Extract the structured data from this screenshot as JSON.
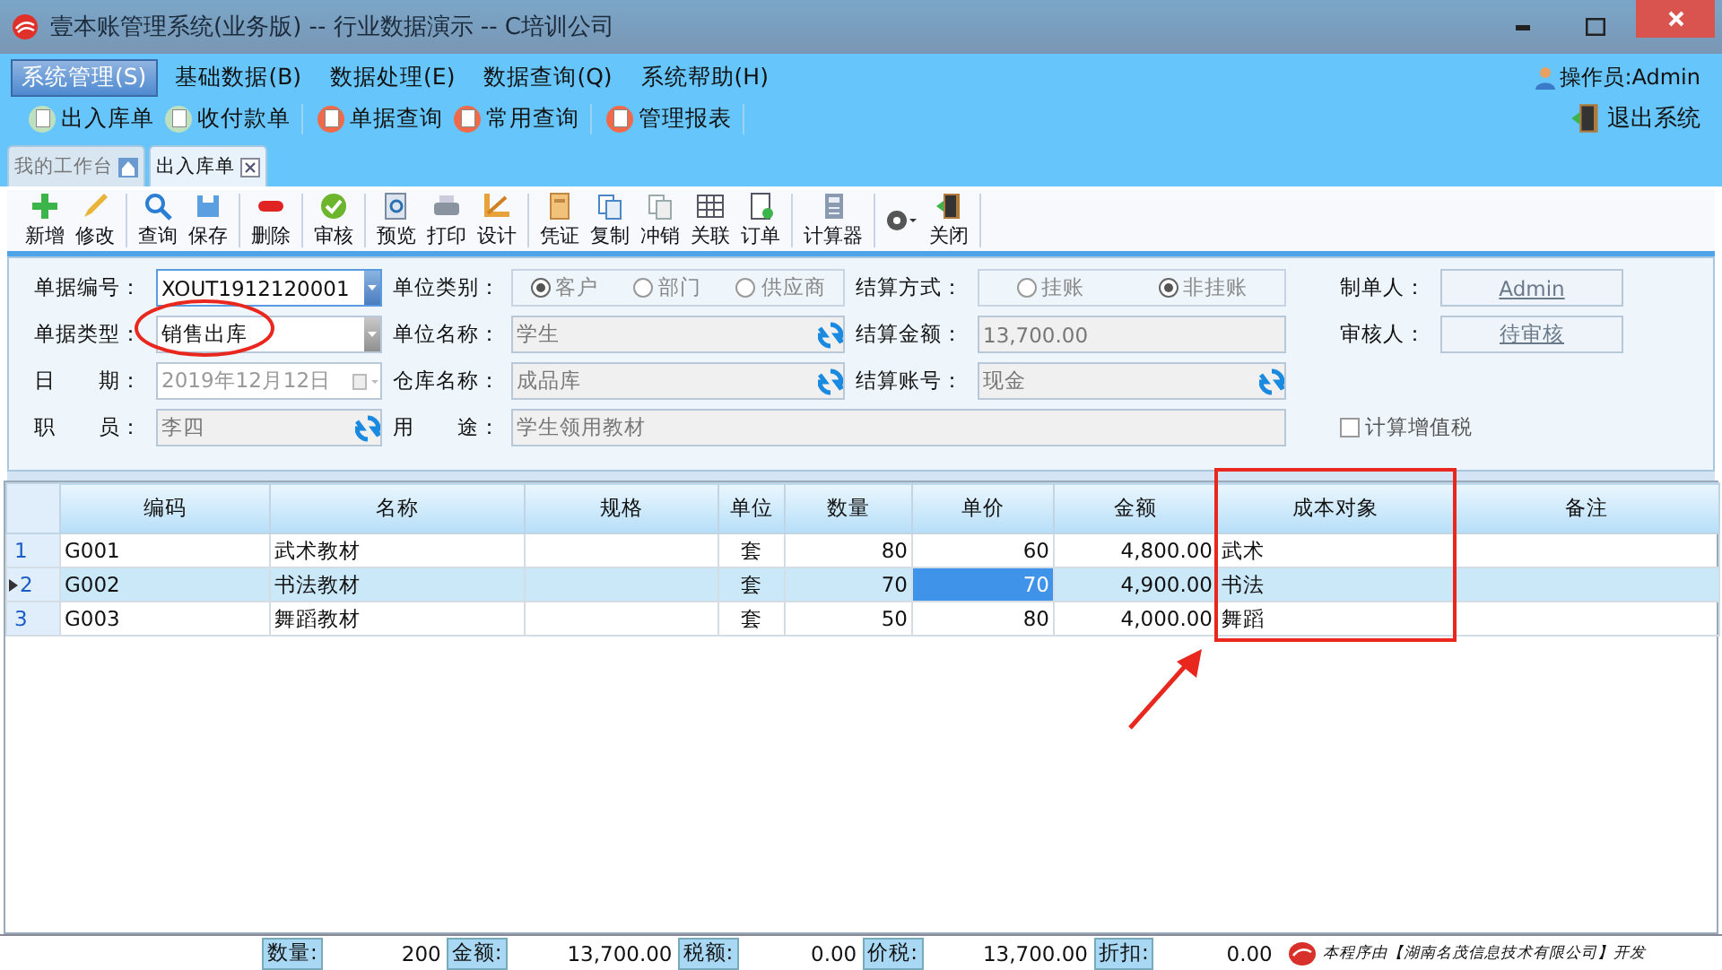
{
  "window": {
    "title": "壹本账管理系统(业务版) -- 行业数据演示 -- C培训公司"
  },
  "menu": [
    {
      "label": "系统管理(S)",
      "selected": true
    },
    {
      "label": "基础数据(B)",
      "selected": false
    },
    {
      "label": "数据处理(E)",
      "selected": false
    },
    {
      "label": "数据查询(Q)",
      "selected": false
    },
    {
      "label": "系统帮助(H)",
      "selected": false
    }
  ],
  "operator": "操作员:Admin",
  "quick_toolbar": [
    [
      "出入库单",
      "收付款单"
    ],
    [
      "单据查询",
      "常用查询"
    ],
    [
      "管理报表"
    ]
  ],
  "exit_button": "退出系统",
  "tabs": [
    {
      "label": "我的工作台",
      "selected": false
    },
    {
      "label": "出入库单",
      "selected": true
    }
  ],
  "toolbar": [
    [
      "新增",
      "修改"
    ],
    [
      "查询",
      "保存"
    ],
    [
      "删除"
    ],
    [
      "审核"
    ],
    [
      "预览",
      "打印",
      "设计"
    ],
    [
      "凭证",
      "复制",
      "冲销",
      "关联",
      "订单"
    ],
    [
      "计算器"
    ],
    [
      "关闭"
    ]
  ],
  "form": {
    "main": [
      [
        {
          "kind": "select",
          "label": "单据编号：",
          "value": "XOUT1912120001",
          "focused": true
        },
        {
          "kind": "radio",
          "label": "单位类别：",
          "options": [
            {
              "label": "客户",
              "selected": true
            },
            {
              "label": "部门",
              "selected": false
            },
            {
              "label": "供应商",
              "selected": false
            }
          ]
        },
        {
          "kind": "radio",
          "label": "结算方式：",
          "options": [
            {
              "label": "挂账",
              "selected": false
            },
            {
              "label": "非挂账",
              "selected": true
            }
          ]
        }
      ],
      [
        {
          "kind": "select",
          "label": "单据类型：",
          "value": "销售出库",
          "focused": false
        },
        {
          "kind": "lookup",
          "label": "单位名称：",
          "value": "学生"
        },
        {
          "kind": "text",
          "label": "结算金额：",
          "value": "13,700.00"
        }
      ],
      [
        {
          "kind": "date",
          "label": "日　　期：",
          "value": "2019年12月12日"
        },
        {
          "kind": "lookup",
          "label": "仓库名称：",
          "value": "成品库"
        },
        {
          "kind": "lookup",
          "label": "结算账号：",
          "value": "现金"
        }
      ],
      [
        {
          "kind": "lookup",
          "label": "职　　员：",
          "value": "李四"
        },
        {
          "kind": "text",
          "label": "用　　途：",
          "value": "学生领用教材"
        }
      ]
    ],
    "side": [
      {
        "label": "制单人：",
        "value": "Admin"
      },
      {
        "label": "审核人：",
        "value": "待审核"
      }
    ],
    "vat_checkbox": {
      "label": "计算增值税",
      "checked": false
    }
  },
  "table": {
    "columns": [
      "编码",
      "名称",
      "规格",
      "单位",
      "数量",
      "单价",
      "金额",
      "成本对象",
      "备注"
    ],
    "rows": [
      {
        "number": "1",
        "selected": false,
        "cells": [
          {
            "text": "G001",
            "focused": false
          },
          {
            "text": "武术教材",
            "focused": false
          },
          {
            "focused": false
          },
          {
            "text": "套",
            "focused": false
          },
          {
            "text": "80",
            "focused": false
          },
          {
            "text": "60",
            "focused": false
          },
          {
            "text": "4,800.00",
            "focused": false
          },
          {
            "text": "武术",
            "focused": false
          },
          {
            "focused": false
          }
        ]
      },
      {
        "number": "2",
        "selected": true,
        "cells": [
          {
            "text": "G002",
            "focused": false
          },
          {
            "text": "书法教材",
            "focused": false
          },
          {
            "focused": false
          },
          {
            "text": "套",
            "focused": false
          },
          {
            "text": "70",
            "focused": false
          },
          {
            "text": "70",
            "focused": true
          },
          {
            "text": "4,900.00",
            "focused": false
          },
          {
            "text": "书法",
            "focused": false
          },
          {
            "focused": false
          }
        ]
      },
      {
        "number": "3",
        "selected": false,
        "cells": [
          {
            "text": "G003",
            "focused": false
          },
          {
            "text": "舞蹈教材",
            "focused": false
          },
          {
            "focused": false
          },
          {
            "text": "套",
            "focused": false
          },
          {
            "text": "50",
            "focused": false
          },
          {
            "text": "80",
            "focused": false
          },
          {
            "text": "4,000.00",
            "focused": false
          },
          {
            "text": "舞蹈",
            "focused": false
          },
          {
            "focused": false
          }
        ]
      }
    ]
  },
  "totals": [
    {
      "label": "数量:",
      "value": "200"
    },
    {
      "label": "金额:",
      "value": "13,700.00"
    },
    {
      "label": "税额:",
      "value": "0.00"
    },
    {
      "label": "价税:",
      "value": "13,700.00"
    },
    {
      "label": "折扣:",
      "value": "0.00"
    }
  ],
  "credit": "本程序由【湖南名茂信息技术有限公司】开发"
}
